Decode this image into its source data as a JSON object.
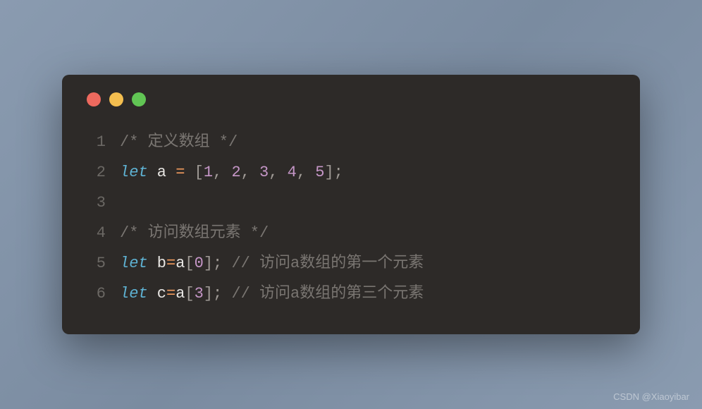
{
  "watermark": "CSDN @Xiaoyibar",
  "window": {
    "controls": [
      "close",
      "minimize",
      "maximize"
    ]
  },
  "code": {
    "lines": [
      {
        "num": "1",
        "tokens": [
          {
            "cls": "tok-comment",
            "text": "/* 定义数组 */"
          }
        ]
      },
      {
        "num": "2",
        "tokens": [
          {
            "cls": "tok-keyword",
            "text": "let"
          },
          {
            "cls": "tok-var",
            "text": " a "
          },
          {
            "cls": "tok-op",
            "text": "="
          },
          {
            "cls": "tok-var",
            "text": " "
          },
          {
            "cls": "tok-punct",
            "text": "["
          },
          {
            "cls": "tok-num",
            "text": "1"
          },
          {
            "cls": "tok-punct",
            "text": ", "
          },
          {
            "cls": "tok-num",
            "text": "2"
          },
          {
            "cls": "tok-punct",
            "text": ", "
          },
          {
            "cls": "tok-num",
            "text": "3"
          },
          {
            "cls": "tok-punct",
            "text": ", "
          },
          {
            "cls": "tok-num",
            "text": "4"
          },
          {
            "cls": "tok-punct",
            "text": ", "
          },
          {
            "cls": "tok-num",
            "text": "5"
          },
          {
            "cls": "tok-punct",
            "text": "];"
          }
        ]
      },
      {
        "num": "3",
        "tokens": []
      },
      {
        "num": "4",
        "tokens": [
          {
            "cls": "tok-comment",
            "text": "/* 访问数组元素 */"
          }
        ]
      },
      {
        "num": "5",
        "tokens": [
          {
            "cls": "tok-keyword",
            "text": "let"
          },
          {
            "cls": "tok-var",
            "text": " b"
          },
          {
            "cls": "tok-op",
            "text": "="
          },
          {
            "cls": "tok-var",
            "text": "a"
          },
          {
            "cls": "tok-punct",
            "text": "["
          },
          {
            "cls": "tok-num",
            "text": "0"
          },
          {
            "cls": "tok-punct",
            "text": "]; "
          },
          {
            "cls": "tok-comment",
            "text": "// 访问a数组的第一个元素"
          }
        ]
      },
      {
        "num": "6",
        "tokens": [
          {
            "cls": "tok-keyword",
            "text": "let"
          },
          {
            "cls": "tok-var",
            "text": " c"
          },
          {
            "cls": "tok-op",
            "text": "="
          },
          {
            "cls": "tok-var",
            "text": "a"
          },
          {
            "cls": "tok-punct",
            "text": "["
          },
          {
            "cls": "tok-num",
            "text": "3"
          },
          {
            "cls": "tok-punct",
            "text": "]; "
          },
          {
            "cls": "tok-comment",
            "text": "// 访问a数组的第三个元素"
          }
        ]
      }
    ]
  }
}
